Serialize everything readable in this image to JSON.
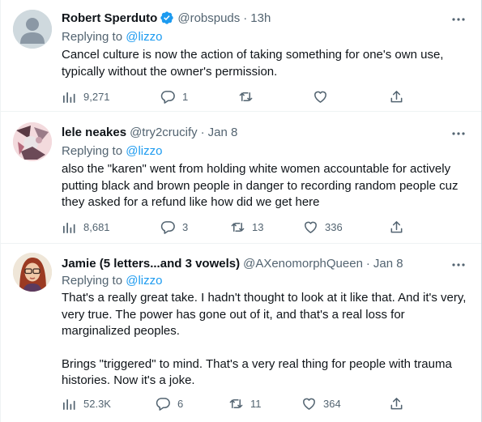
{
  "tweets": [
    {
      "name": "Robert Sperduto",
      "verified": true,
      "handle": "@robspuds",
      "time": "13h",
      "replying_prefix": "Replying to ",
      "replying_to": "@lizzo",
      "paragraphs": [
        "Cancel culture is now the action of taking something for one's own use, typically without the owner's permission."
      ],
      "views": "9,271",
      "replies": "1",
      "retweets": "",
      "likes": ""
    },
    {
      "name": "lele neakes",
      "verified": false,
      "handle": "@try2crucify",
      "time": "Jan 8",
      "replying_prefix": "Replying to ",
      "replying_to": "@lizzo",
      "paragraphs": [
        "also the \"karen\" went from holding white women accountable for actively putting black and brown people in danger to recording random people cuz they asked for a refund like how did we get here"
      ],
      "views": "8,681",
      "replies": "3",
      "retweets": "13",
      "likes": "336"
    },
    {
      "name": "Jamie (5 letters...and 3 vowels)",
      "verified": false,
      "handle": "@AXenomorphQueen",
      "time": "Jan 8",
      "replying_prefix": "Replying to ",
      "replying_to": "@lizzo",
      "paragraphs": [
        "That's a really great take. I hadn't thought to look at it like that. And it's very, very true. The power has gone out of it, and that's a real loss for marginalized peoples.",
        "Brings \"triggered\" to mind. That's a very real thing for people with trauma histories. Now it's a joke."
      ],
      "views": "52.3K",
      "replies": "6",
      "retweets": "11",
      "likes": "364"
    }
  ],
  "separator": "·",
  "icons": {
    "views": "bar-chart-icon",
    "reply": "speech-bubble-icon",
    "retweet": "retweet-icon",
    "like": "heart-icon",
    "share": "share-icon",
    "more": "more-dots-icon",
    "verified": "verified-badge-icon"
  },
  "colors": {
    "text": "#0f1419",
    "secondary": "#536471",
    "accent": "#1d9bf0",
    "divider": "#eff3f4"
  }
}
